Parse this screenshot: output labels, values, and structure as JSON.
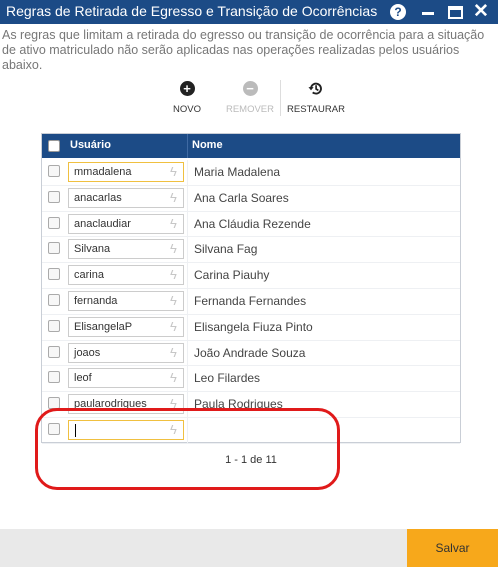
{
  "window": {
    "title": "Regras de Retirada de Egresso e Transição de Ocorrências",
    "help_label": "?"
  },
  "description": "As regras que limitam a retirada do egresso ou transição de ocorrência para a situação de ativo matriculado não serão aplicadas nas operações realizadas pelos usuários abaixo.",
  "toolbar": {
    "novo_label": "NOVO",
    "remover_label": "REMOVER",
    "restaurar_label": "RESTAURAR"
  },
  "grid": {
    "columns": [
      "Usuário",
      "Nome"
    ],
    "rows": [
      {
        "usuario": "mmadalena",
        "nome": "Maria Madalena"
      },
      {
        "usuario": "anacarlas",
        "nome": "Ana Carla Soares"
      },
      {
        "usuario": "anaclaudiar",
        "nome": "Ana Cláudia Rezende"
      },
      {
        "usuario": "Silvana",
        "nome": "Silvana Fag"
      },
      {
        "usuario": "carina",
        "nome": "Carina Piauhy"
      },
      {
        "usuario": "fernanda",
        "nome": "Fernanda Fernandes"
      },
      {
        "usuario": "ElisangelaP",
        "nome": "Elisangela Fiuza Pinto"
      },
      {
        "usuario": "joaos",
        "nome": "João Andrade Souza"
      },
      {
        "usuario": "leof",
        "nome": "Leo Filardes"
      },
      {
        "usuario": "paularodrigues",
        "nome": "Paula Rodrigues"
      }
    ],
    "new_row": {
      "usuario": "",
      "nome": ""
    },
    "pager": "1 - 1 de 11"
  },
  "footer": {
    "save_label": "Salvar"
  },
  "colors": {
    "header_blue": "#1c4b86",
    "save_orange": "#f7a81b",
    "annotation_red": "#e01a1a"
  },
  "icons": {
    "novo": "plus-circle-icon",
    "remover": "minus-circle-icon",
    "restaurar": "history-icon",
    "field_action": "lightning-icon"
  }
}
